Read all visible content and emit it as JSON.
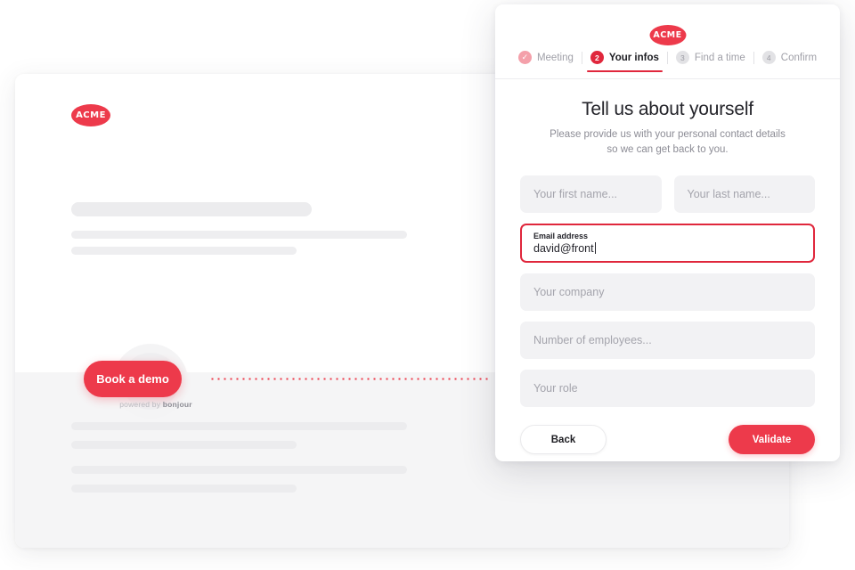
{
  "host_page": {
    "logo_text": "ACME",
    "demo_button_label": "Book a demo",
    "powered_by_prefix": "powered by ",
    "powered_by_brand": "bonjour"
  },
  "modal": {
    "logo_text": "ACME",
    "stepper": [
      {
        "number": "✓",
        "label": "Meeting",
        "state": "done"
      },
      {
        "number": "2",
        "label": "Your infos",
        "state": "current"
      },
      {
        "number": "3",
        "label": "Find a time",
        "state": "todo"
      },
      {
        "number": "4",
        "label": "Confirm",
        "state": "todo"
      }
    ],
    "title": "Tell us about yourself",
    "subtitle_line1": "Please provide us with your personal contact details",
    "subtitle_line2": "so we can get back to you.",
    "fields": {
      "first_name_placeholder": "Your first name...",
      "last_name_placeholder": "Your last name...",
      "email_label": "Email address",
      "email_value": "david@front",
      "company_placeholder": "Your company",
      "employees_placeholder": "Number of employees...",
      "role_placeholder": "Your role"
    },
    "buttons": {
      "back": "Back",
      "validate": "Validate"
    }
  },
  "colors": {
    "brand_red": "#ed3a4b",
    "active_red": "#e0273c",
    "field_bg": "#f2f2f4",
    "skeleton": "#ececee"
  }
}
